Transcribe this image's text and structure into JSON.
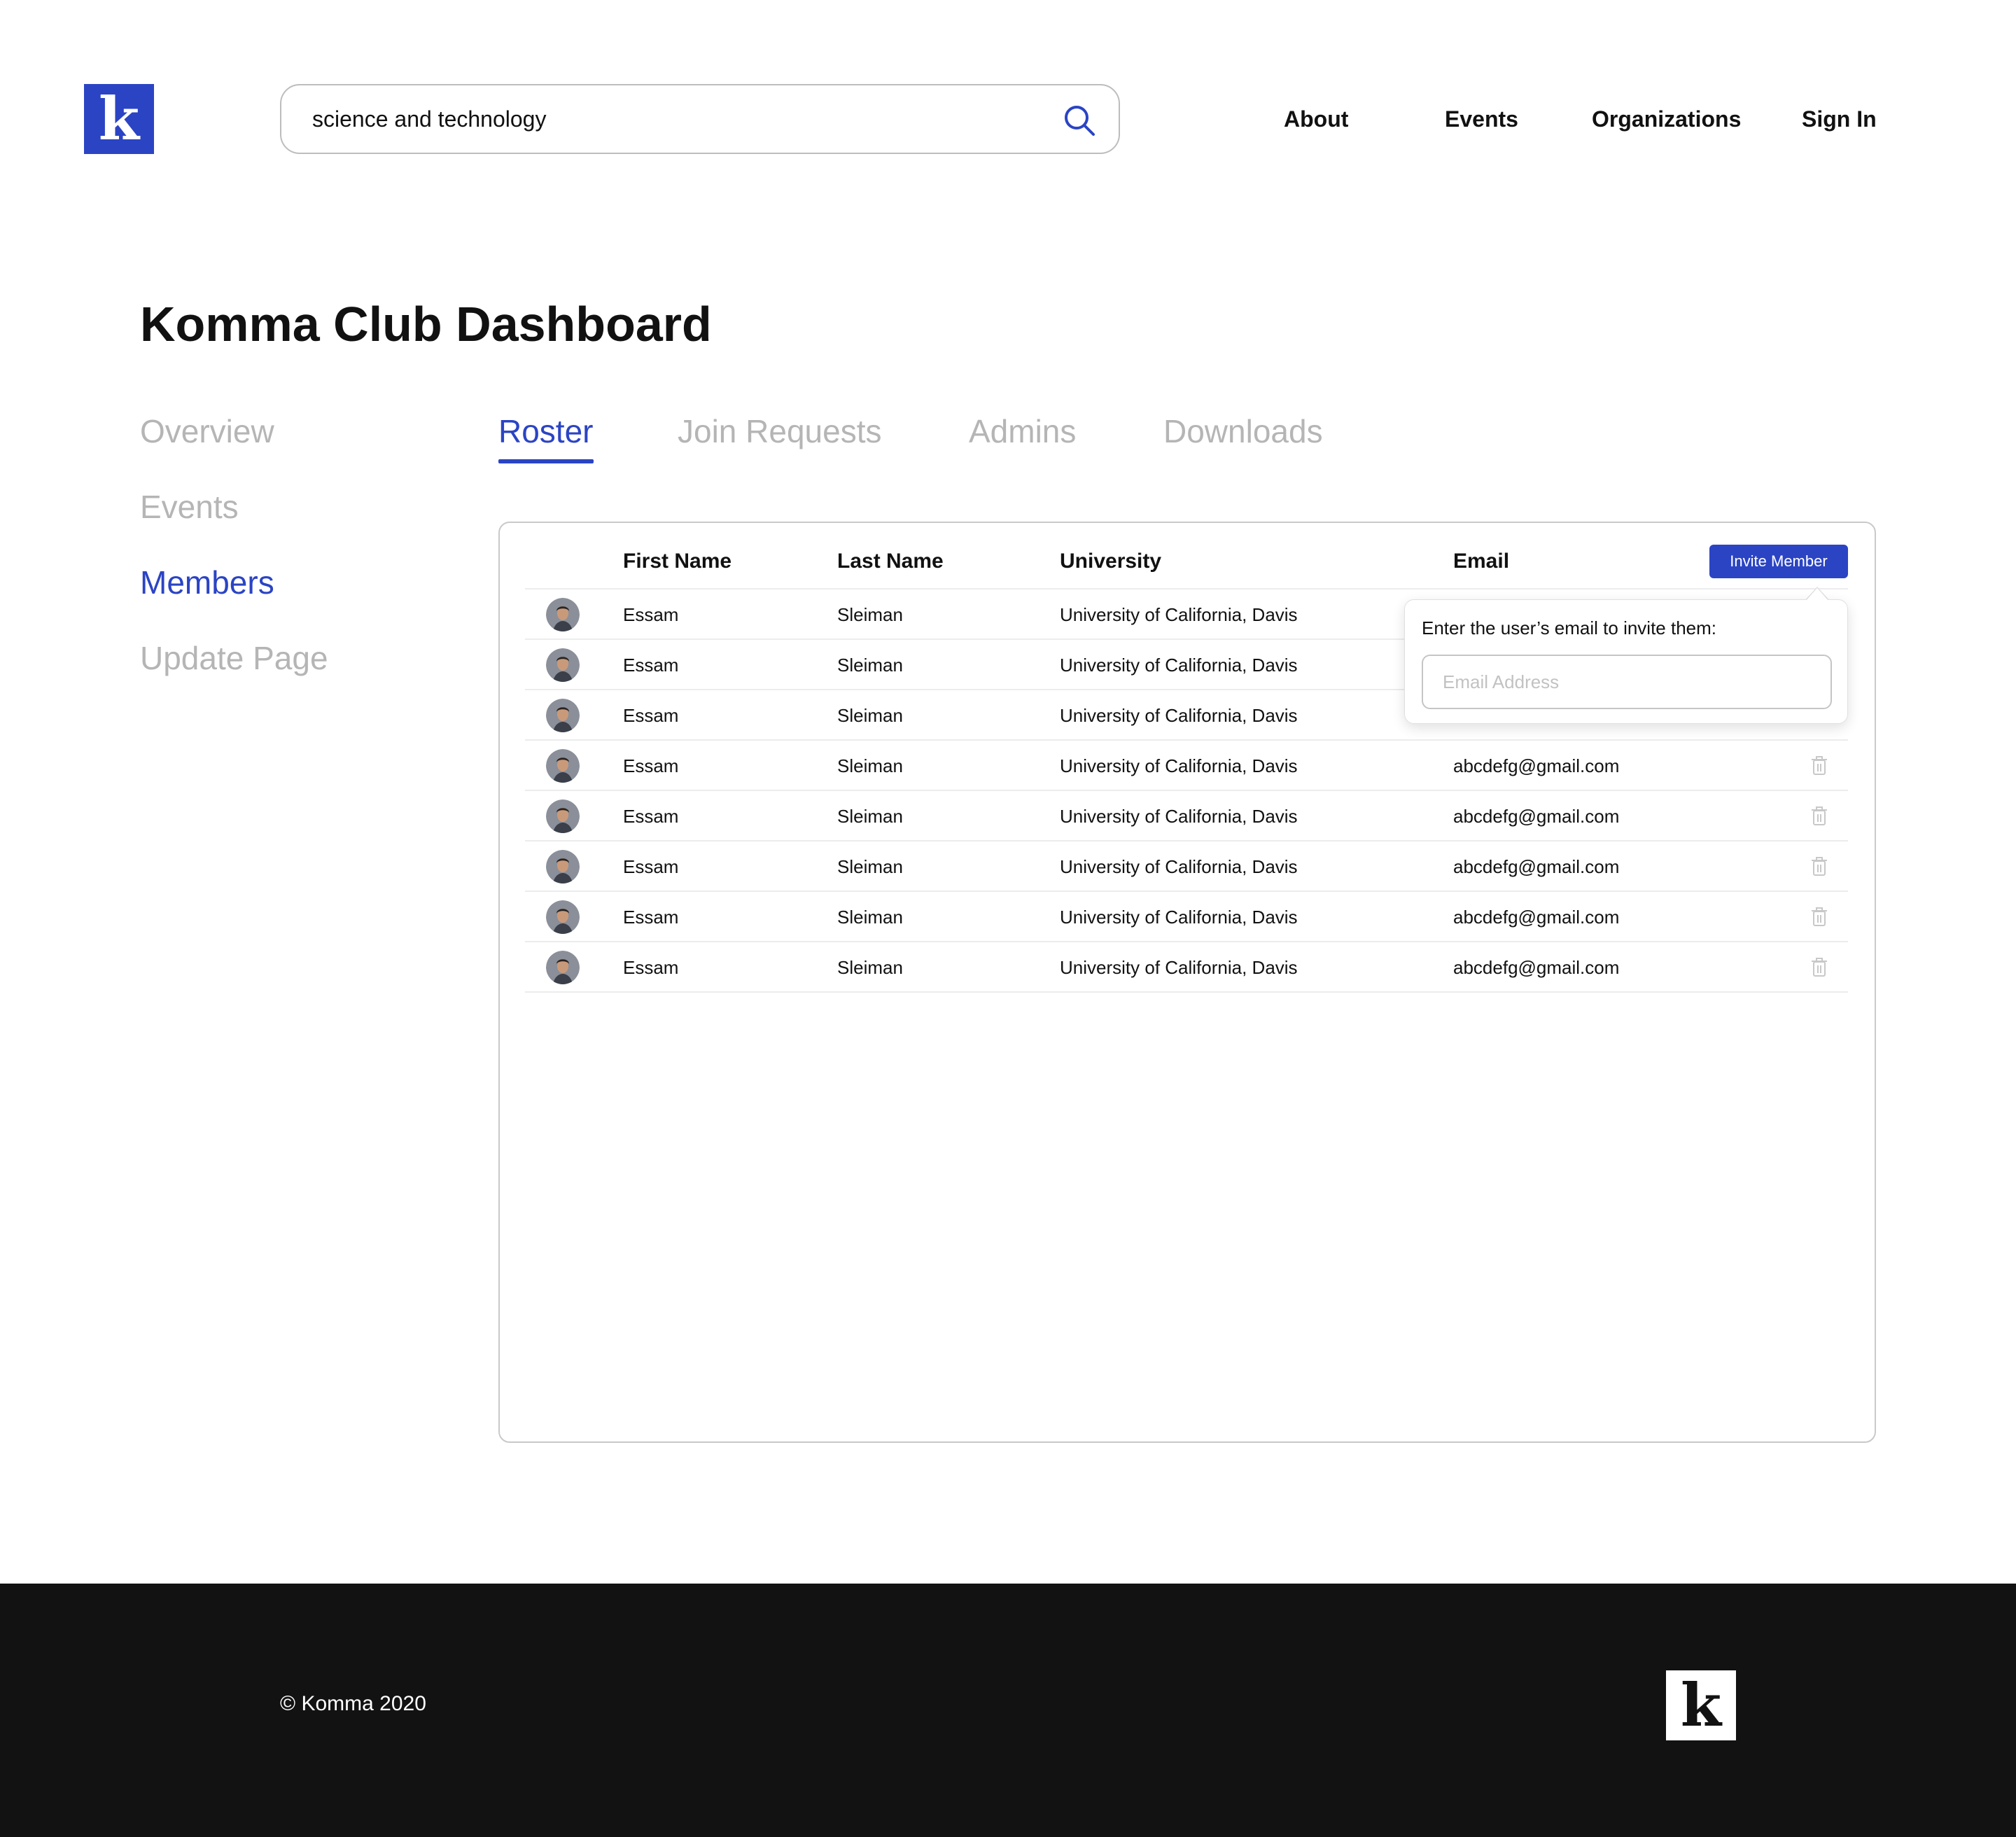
{
  "header": {
    "logo_letter": "k",
    "search_value": "science and technology",
    "nav": [
      "About",
      "Events",
      "Organizations",
      "Sign In"
    ]
  },
  "page_title": "Komma Club Dashboard",
  "sidebar": {
    "items": [
      {
        "label": "Overview",
        "active": false
      },
      {
        "label": "Events",
        "active": false
      },
      {
        "label": "Members",
        "active": true
      },
      {
        "label": "Update Page",
        "active": false
      }
    ]
  },
  "tabs": [
    {
      "label": "Roster",
      "active": true
    },
    {
      "label": "Join Requests",
      "active": false
    },
    {
      "label": "Admins",
      "active": false
    },
    {
      "label": "Downloads",
      "active": false
    }
  ],
  "roster": {
    "columns": [
      "First Name",
      "Last Name",
      "University",
      "Email"
    ],
    "invite_label": "Invite Member",
    "rows": [
      {
        "first": "Essam",
        "last": "Sleiman",
        "university": "University of California, Davis",
        "email": ""
      },
      {
        "first": "Essam",
        "last": "Sleiman",
        "university": "University of California, Davis",
        "email": ""
      },
      {
        "first": "Essam",
        "last": "Sleiman",
        "university": "University of California, Davis",
        "email": ""
      },
      {
        "first": "Essam",
        "last": "Sleiman",
        "university": "University of California, Davis",
        "email": "abcdefg@gmail.com"
      },
      {
        "first": "Essam",
        "last": "Sleiman",
        "university": "University of California, Davis",
        "email": "abcdefg@gmail.com"
      },
      {
        "first": "Essam",
        "last": "Sleiman",
        "university": "University of California, Davis",
        "email": "abcdefg@gmail.com"
      },
      {
        "first": "Essam",
        "last": "Sleiman",
        "university": "University of California, Davis",
        "email": "abcdefg@gmail.com"
      },
      {
        "first": "Essam",
        "last": "Sleiman",
        "university": "University of California, Davis",
        "email": "abcdefg@gmail.com"
      }
    ]
  },
  "invite_popover": {
    "prompt": "Enter the user’s email to invite them:",
    "email_placeholder": "Email Address",
    "email_value": ""
  },
  "footer": {
    "copyright": "© Komma 2020",
    "logo_letter": "k"
  },
  "colors": {
    "accent": "#2b44c4",
    "inactive_text": "#b5b5b5",
    "footer_bg": "#121212"
  },
  "icons": [
    "search-icon",
    "trash-icon",
    "avatar"
  ]
}
